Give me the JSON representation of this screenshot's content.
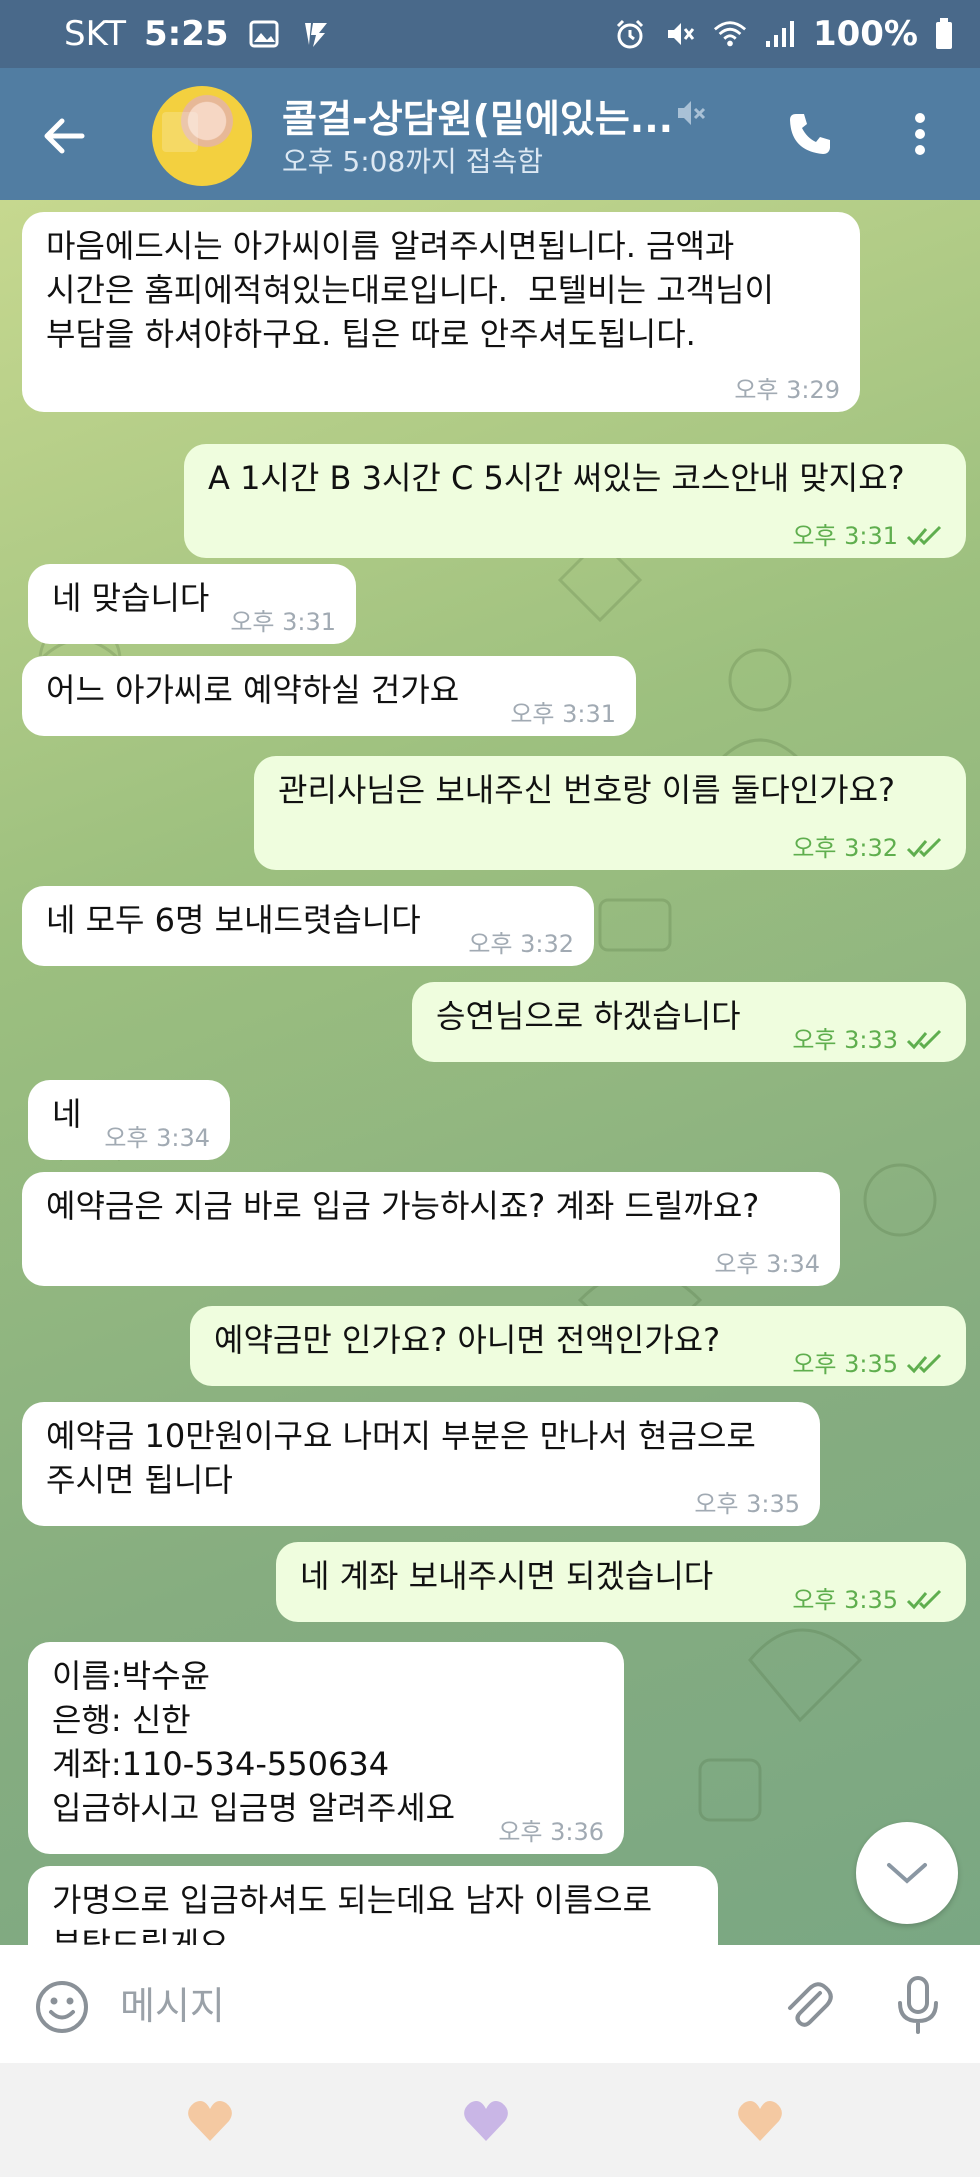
{
  "status_bar": {
    "carrier": "SKT",
    "time": "5:25",
    "battery": "100%",
    "icons": [
      "image-icon",
      "lightning-icon",
      "alarm-icon",
      "mute-icon",
      "wifi-icon",
      "signal-icon",
      "battery-icon"
    ]
  },
  "header": {
    "title": "콜걸-상담원(밑에있는...",
    "subtitle": "오후 5:08까지 접속함",
    "colors": {
      "header": "#517da2",
      "status_bar": "#49698a"
    }
  },
  "messages": [
    {
      "side": "in",
      "text": "마음에드시는 아가씨이름 알려주시면됩니다. 금액과\n시간은 홈피에적혀있는대로입니다.  모텔비는 고객님이\n부담을 하셔야하구요. 팁은 따로 안주셔도됩니다.",
      "time": "오후 3:29"
    },
    {
      "side": "out",
      "text": "A 1시간 B 3시간 C 5시간 써있는 코스안내 맞지요?",
      "time": "오후 3:31"
    },
    {
      "side": "in",
      "text": "네 맞습니다",
      "time": "오후 3:31"
    },
    {
      "side": "in",
      "text": "어느 아가씨로 예약하실 건가요",
      "time": "오후 3:31"
    },
    {
      "side": "out",
      "text": "관리사님은 보내주신 번호랑 이름 둘다인가요?",
      "time": "오후 3:32"
    },
    {
      "side": "in",
      "text": "네 모두 6명 보내드렷습니다",
      "time": "오후 3:32"
    },
    {
      "side": "out",
      "text": "승연님으로 하겠습니다",
      "time": "오후 3:33"
    },
    {
      "side": "in",
      "text": "네",
      "time": "오후 3:34"
    },
    {
      "side": "in",
      "text": "예약금은 지금 바로 입금 가능하시죠? 계좌 드릴까요?",
      "time": "오후 3:34"
    },
    {
      "side": "out",
      "text": "예약금만 인가요? 아니면 전액인가요?",
      "time": "오후 3:35"
    },
    {
      "side": "in",
      "text": "예약금 10만원이구요 나머지 부분은 만나서 현금으로\n주시면 됩니다",
      "time": "오후 3:35"
    },
    {
      "side": "out",
      "text": "네 계좌 보내주시면 되겠습니다",
      "time": "오후 3:35"
    },
    {
      "side": "in",
      "text": "이름:박수윤\n은행: 신한\n계좌:110-534-550634\n입금하시고 입금명 알려주세요",
      "time": "오후 3:36"
    },
    {
      "side": "in",
      "text": "가명으로 입금하셔도 되는데요 남자 이름으로\n부탁드릴게요",
      "time": ""
    }
  ],
  "composer": {
    "placeholder": "메시지"
  },
  "nav_icons": [
    "heart-peach-icon",
    "heart-purple-icon",
    "heart-peach-icon"
  ]
}
